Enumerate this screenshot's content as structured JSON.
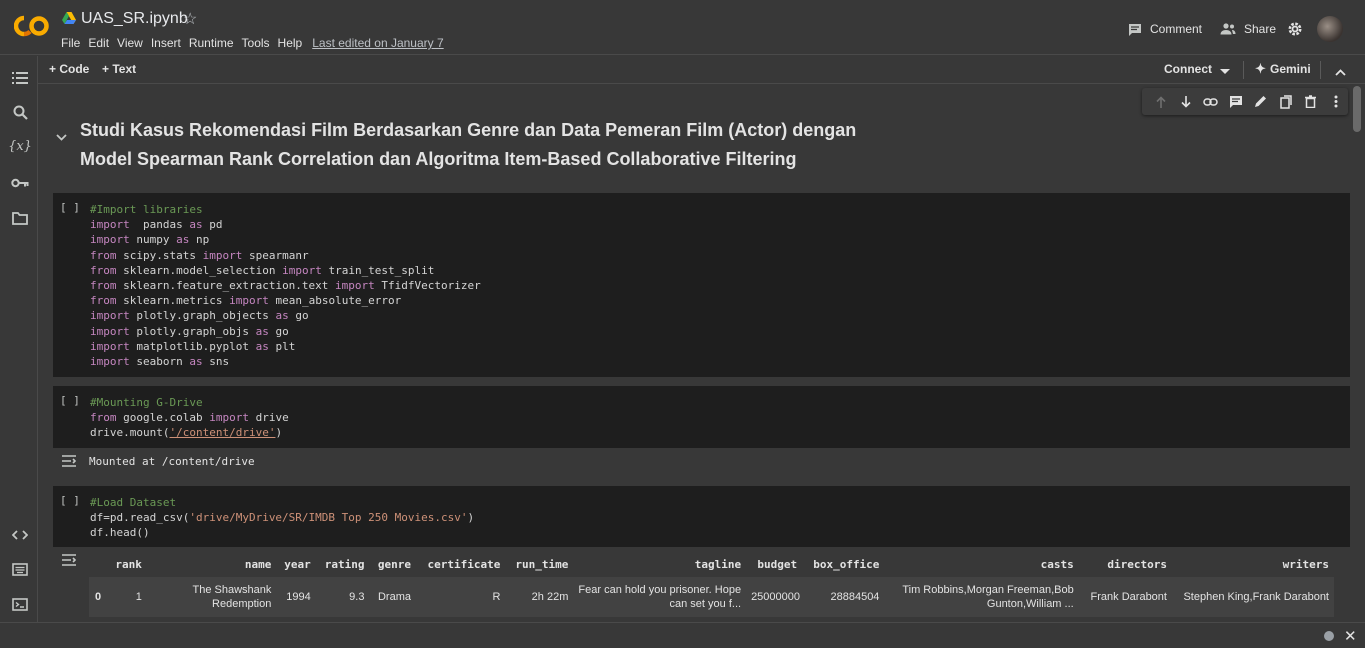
{
  "app": {
    "logo_text": "CO",
    "title": "UAS_SR.ipynb",
    "edited": "Last edited on January 7"
  },
  "menu": [
    "File",
    "Edit",
    "View",
    "Insert",
    "Runtime",
    "Tools",
    "Help"
  ],
  "header": {
    "comment": "Comment",
    "share": "Share"
  },
  "toolbar": {
    "code": "+ Code",
    "text": "+ Text",
    "connect": "Connect",
    "gemini": "Gemini"
  },
  "heading": {
    "line1": "Studi Kasus Rekomendasi Film Berdasarkan Genre dan Data Pemeran Film (Actor) dengan",
    "line2": "Model Spearman Rank Correlation dan Algoritma Item-Based Collaborative Filtering"
  },
  "cells": {
    "bracket": "[ ]",
    "c1": [
      [
        [
          "cm",
          "#Import libraries"
        ]
      ],
      [
        [
          "kw",
          "import"
        ],
        [
          "",
          "  pandas "
        ],
        [
          "kw",
          "as"
        ],
        [
          "",
          " pd"
        ]
      ],
      [
        [
          "kw",
          "import"
        ],
        [
          "",
          " numpy "
        ],
        [
          "kw",
          "as"
        ],
        [
          "",
          " np"
        ]
      ],
      [
        [
          "kw",
          "from"
        ],
        [
          "",
          " scipy.stats "
        ],
        [
          "kw",
          "import"
        ],
        [
          "",
          " spearmanr"
        ]
      ],
      [
        [
          "kw",
          "from"
        ],
        [
          "",
          " sklearn.model_selection "
        ],
        [
          "kw",
          "import"
        ],
        [
          "",
          " train_test_split"
        ]
      ],
      [
        [
          "kw",
          "from"
        ],
        [
          "",
          " sklearn.feature_extraction.text "
        ],
        [
          "kw",
          "import"
        ],
        [
          "",
          " TfidfVectorizer"
        ]
      ],
      [
        [
          "kw",
          "from"
        ],
        [
          "",
          " sklearn.metrics "
        ],
        [
          "kw",
          "import"
        ],
        [
          "",
          " mean_absolute_error"
        ]
      ],
      [
        [
          "kw",
          "import"
        ],
        [
          "",
          " plotly.graph_objects "
        ],
        [
          "kw",
          "as"
        ],
        [
          "",
          " go"
        ]
      ],
      [
        [
          "kw",
          "import"
        ],
        [
          "",
          " plotly.graph_objs "
        ],
        [
          "kw",
          "as"
        ],
        [
          "",
          " go"
        ]
      ],
      [
        [
          "kw",
          "import"
        ],
        [
          "",
          " matplotlib.pyplot "
        ],
        [
          "kw",
          "as"
        ],
        [
          "",
          " plt"
        ]
      ],
      [
        [
          "kw",
          "import"
        ],
        [
          "",
          " seaborn "
        ],
        [
          "kw",
          "as"
        ],
        [
          "",
          " sns"
        ]
      ]
    ],
    "c2": [
      [
        [
          "cm",
          "#Mounting G-Drive"
        ]
      ],
      [
        [
          "kw",
          "from"
        ],
        [
          "",
          " google.colab "
        ],
        [
          "kw",
          "import"
        ],
        [
          "",
          " drive"
        ]
      ],
      [
        [
          "",
          "drive.mount("
        ],
        [
          "st",
          "'/content/drive'"
        ],
        [
          "",
          ")"
        ]
      ]
    ],
    "c2_output": "Mounted at /content/drive",
    "c3": [
      [
        [
          "cm",
          "#Load Dataset"
        ]
      ],
      [
        [
          "",
          "df=pd.read_csv("
        ],
        [
          "st",
          "'drive/MyDrive/SR/IMDB Top 250 Movies.csv'"
        ],
        [
          "",
          ")"
        ]
      ],
      [
        [
          "",
          "df.head()"
        ]
      ]
    ]
  },
  "table": {
    "columns": [
      "",
      "rank",
      "name",
      "year",
      "rating",
      "genre",
      "certificate",
      "run_time",
      "tagline",
      "budget",
      "box_office",
      "casts",
      "directors",
      "writers"
    ],
    "rows": [
      [
        "0",
        "1",
        "The Shawshank Redemption",
        "1994",
        "9.3",
        "Drama",
        "R",
        "2h 22m",
        "Fear can hold you prisoner. Hope can set you f...",
        "25000000",
        "28884504",
        "Tim Robbins,Morgan Freeman,Bob Gunton,William ...",
        "Frank Darabont",
        "Stephen King,Frank Darabont"
      ]
    ]
  }
}
